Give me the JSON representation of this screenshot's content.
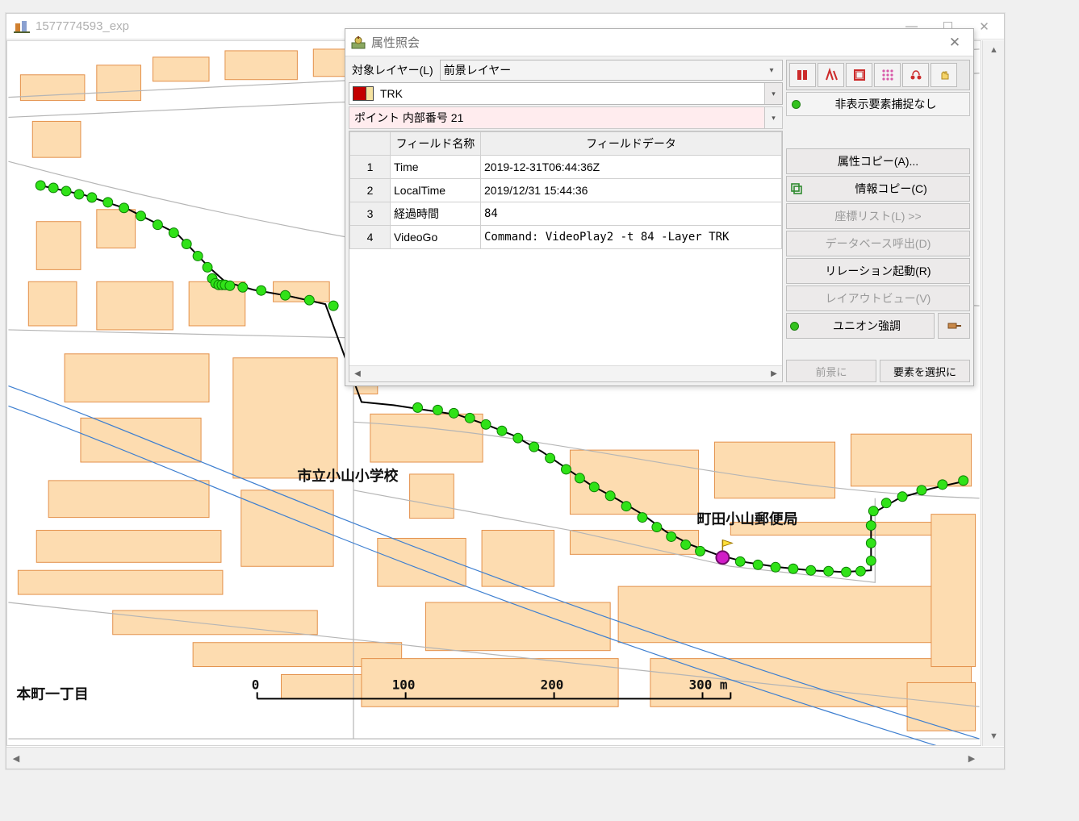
{
  "main_window": {
    "title": "1577774593_exp"
  },
  "dialog": {
    "title": "属性照会",
    "target_layer_label": "対象レイヤー(L)",
    "target_layer_value": "前景レイヤー",
    "trk_value": "TRK",
    "point_select_value": "ポイント 内部番号 21",
    "headers": {
      "field_name": "フィールド名称",
      "field_data": "フィールドデータ"
    },
    "rows": [
      {
        "n": "1",
        "name": "Time",
        "data": "2019-12-31T06:44:36Z"
      },
      {
        "n": "2",
        "name": "LocalTime",
        "data": "2019/12/31 15:44:36"
      },
      {
        "n": "3",
        "name": "経過時間",
        "data": "      84"
      },
      {
        "n": "4",
        "name": "VideoGo",
        "data": "Command: VideoPlay2 -t       84 -Layer TRK"
      }
    ],
    "status_text": "非表示要素捕捉なし",
    "buttons": {
      "copy_attr": "属性コピー(A)...",
      "copy_info": "情報コピー(C)",
      "coord_list": "座標リスト(L) >>",
      "db_call": "データベース呼出(D)",
      "relation": "リレーション起動(R)",
      "layout_view": "レイアウトビュー(V)",
      "union": "ユニオン強調",
      "to_fore": "前景に",
      "select_elem": "要素を選択に"
    }
  },
  "map": {
    "labels": {
      "school": "市立小山小学校",
      "post": "町田小山郵便局",
      "honmachi": "本町一丁目"
    },
    "scale": {
      "ticks": [
        "0",
        "100",
        "200",
        "300 m"
      ]
    }
  }
}
